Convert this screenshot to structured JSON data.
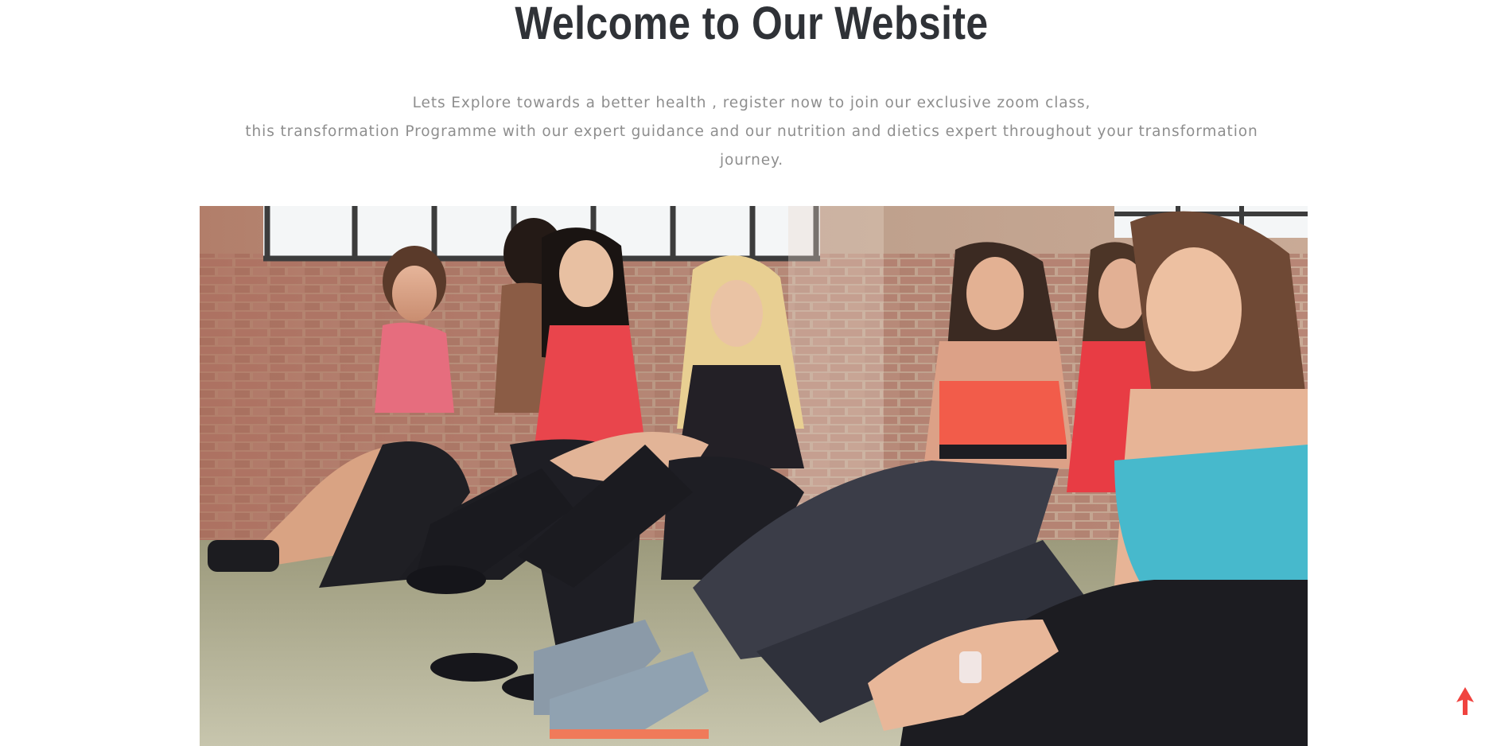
{
  "hero": {
    "title": "Welcome to Our Website",
    "lines": [
      "Lets Explore towards a better health , register now to join our exclusive zoom class,",
      "this transformation Programme with our expert guidance and our nutrition and dietics expert throughout your transformation",
      "journey."
    ]
  },
  "photo": {
    "subject": "group of women in fitness wear sitting on a studio floor"
  },
  "scroll_top": {
    "icon": "arrow-up-icon",
    "color": "#f0433f"
  },
  "colors": {
    "title": "#2f3237",
    "body_text": "#8e8e8e",
    "background": "#ffffff"
  }
}
